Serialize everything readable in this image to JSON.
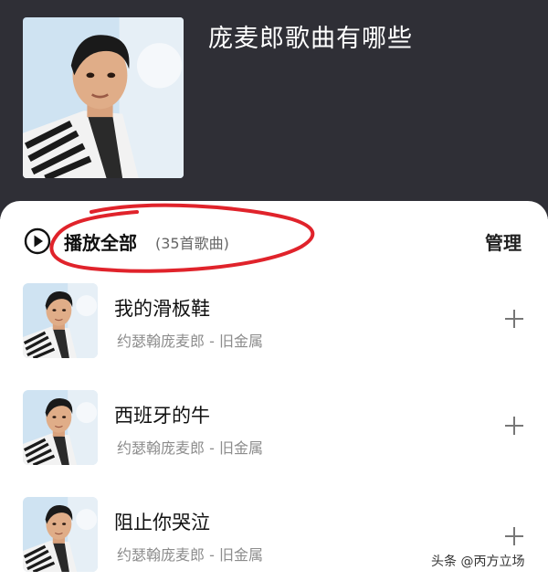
{
  "playlist": {
    "title": "庞麦郎歌曲有哪些",
    "cover_icon": "artist-portrait"
  },
  "toolbar": {
    "play_all_label": "播放全部",
    "song_count": "(35首歌曲)",
    "manage_label": "管理",
    "play_icon": "play-circle-icon"
  },
  "songs": [
    {
      "title": "我的滑板鞋",
      "subtitle": "约瑟翰庞麦郎 - 旧金属"
    },
    {
      "title": "西班牙的牛",
      "subtitle": "约瑟翰庞麦郎 - 旧金属"
    },
    {
      "title": "阻止你哭泣",
      "subtitle": "约瑟翰庞麦郎 - 旧金属"
    }
  ],
  "watermark": "头条 @丙方立场",
  "colors": {
    "header_bg": "#2f2f36",
    "annotation_red": "#e0232b",
    "secondary_text": "#8c8c8c"
  }
}
